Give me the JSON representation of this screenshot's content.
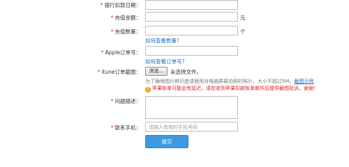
{
  "form": {
    "bank_date": {
      "label": "银行扣款日期：",
      "value": ""
    },
    "amount": {
      "label": "充值金额：",
      "value": "",
      "unit": "元"
    },
    "quantity": {
      "label": "充值数量：",
      "value": "",
      "unit": "个",
      "help_link": "如何查看数量？"
    },
    "apple_order": {
      "label": "Apple订单号：",
      "value": "",
      "help_link": "如何查看订单号？"
    },
    "itunes_screenshot": {
      "label": "itune订单截图：",
      "browse_button": "浏览...",
      "file_status": "未选择文件。",
      "note": "为了确保图片辨识度请使用对电脑屏幕拍照的照片，大小不超过5M。",
      "sample_link": "截图示例",
      "warning": "苹果账单可能会有延迟，请在收到苹果扣款账单邮件后提供截图投诉，谢谢！"
    },
    "problem": {
      "label": "问题描述：",
      "value": ""
    },
    "phone": {
      "label": "联系手机：",
      "placeholder": "请输入有效的手机号码"
    },
    "submit_label": "提交"
  },
  "colors": {
    "required": "#e02020",
    "link": "#1c6fc2",
    "button": "#3e9ae0",
    "warning_icon": "#f29a1d"
  },
  "icons": {
    "warning": "warning-icon"
  }
}
